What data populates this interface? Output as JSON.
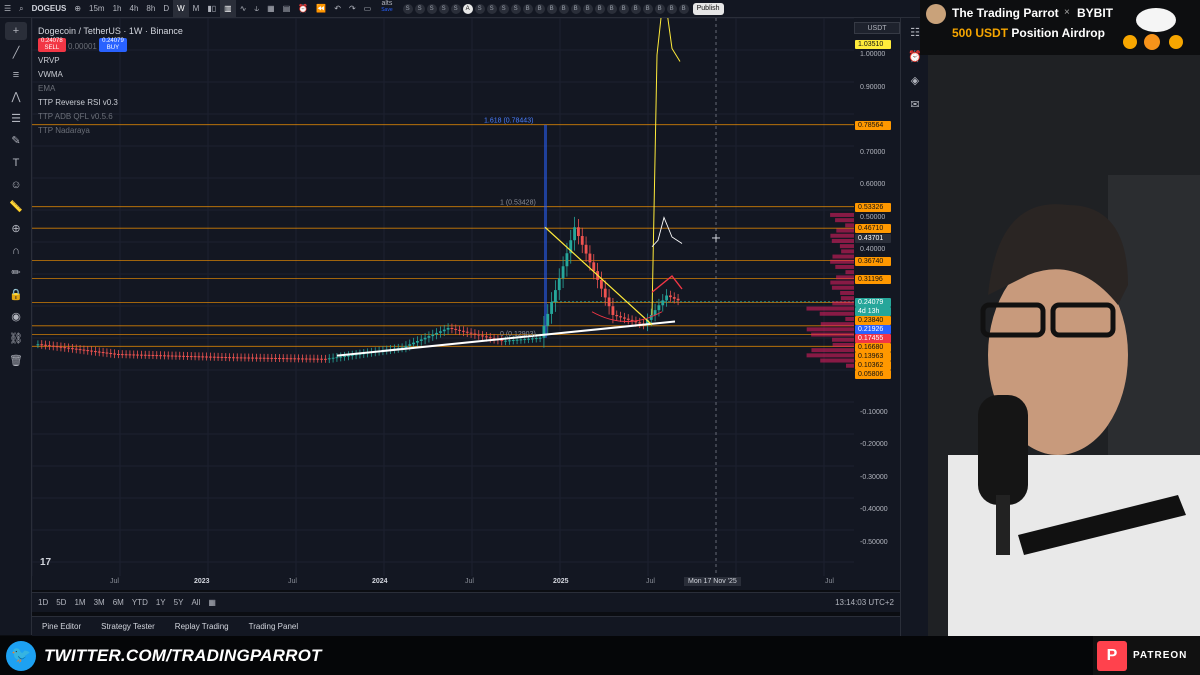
{
  "toolbar": {
    "symbol": "DOGEUS",
    "intervals": [
      "15m",
      "1h",
      "4h",
      "8h",
      "D",
      "W",
      "M"
    ],
    "active_interval": "W",
    "watchlist_name": "alts",
    "watchlist_sub": "Save",
    "watchlist_letters": [
      "S",
      "S",
      "S",
      "S",
      "S",
      "A",
      "S",
      "S",
      "S",
      "S",
      "B",
      "B",
      "B",
      "B",
      "B",
      "B",
      "B",
      "B",
      "B",
      "B",
      "B",
      "B",
      "B",
      "B"
    ],
    "publish_label": "Publish"
  },
  "legend": {
    "title": "Dogecoin / TetherUS · 1W · Binance",
    "sell_price": "0.24078",
    "sell_label": "SELL",
    "spread": "0.00001",
    "buy_price": "0.24079",
    "buy_label": "BUY",
    "indicators": [
      "VRVP",
      "VWMA",
      "EMA",
      "TTP Reverse RSI v0.3",
      "TTP ADB QFL v0.5.6",
      "TTP Nadaraya"
    ]
  },
  "chart_annotations": {
    "fib_top": "1.618 (0.78443)",
    "fib_mid": "1 (0.53428)",
    "fib_low": "0 (0.12903)"
  },
  "price_scale": {
    "currency": "USDT",
    "ticks": [
      "1.00000",
      "0.90000",
      "0.70000",
      "0.60000",
      "0.50000",
      "0.40000",
      "-0.10000",
      "-0.20000",
      "-0.30000",
      "-0.40000",
      "-0.50000"
    ],
    "labels": [
      {
        "text": "1.03510",
        "color": "#ffeb3b"
      },
      {
        "text": "0.78564",
        "color": "#ff9800"
      },
      {
        "text": "0.53326",
        "color": "#ff9800"
      },
      {
        "text": "0.46710",
        "color": "#ff9800"
      },
      {
        "text": "0.43701",
        "color": "#2a2e39"
      },
      {
        "text": "0.36740",
        "color": "#ff9800"
      },
      {
        "text": "0.31196",
        "color": "#ff9800"
      },
      {
        "text": "0.24079",
        "color": "#26a69a"
      },
      {
        "text": "4d 13h",
        "color": "#26a69a"
      },
      {
        "text": "0.23840",
        "color": "#ff9800"
      },
      {
        "text": "0.21926",
        "color": "#2962ff"
      },
      {
        "text": "0.17455",
        "color": "#f23645"
      },
      {
        "text": "0.16680",
        "color": "#ff9800"
      },
      {
        "text": "0.13963",
        "color": "#ff9800"
      },
      {
        "text": "0.10362",
        "color": "#ff9800"
      },
      {
        "text": "0.05806",
        "color": "#ff9800"
      }
    ]
  },
  "time_axis": {
    "labels": [
      "Jul",
      "2023",
      "Jul",
      "2024",
      "Jul",
      "2025",
      "Jul",
      "'25",
      "Jul"
    ],
    "cursor_date": "Mon 17 Nov '25"
  },
  "range_bar": {
    "ranges": [
      "1D",
      "5D",
      "1M",
      "3M",
      "6M",
      "YTD",
      "1Y",
      "5Y",
      "All"
    ],
    "clock": "13:14:03 UTC+2"
  },
  "bottom_tabs": [
    "Pine Editor",
    "Strategy Tester",
    "Replay Trading",
    "Trading Panel"
  ],
  "overlay": {
    "twitter_prefix": "TWITTER.COM/",
    "twitter_handle": "TRADINGPARROT",
    "patreon": "PATREON",
    "sponsor_name": "The Trading Parrot",
    "sponsor_x": "×",
    "sponsor_brand": "BYBIT",
    "promo_amount": "500 USDT",
    "promo_text": "Position Airdrop"
  },
  "chart_data": {
    "type": "candlestick",
    "symbol": "DOGEUSDT",
    "timeframe": "1W",
    "x_range": [
      "2022-03",
      "2025-11"
    ],
    "y_range": [
      -0.55,
      1.05
    ],
    "horizontal_levels": [
      0.78564,
      0.53326,
      0.4671,
      0.3674,
      0.31196,
      0.2384,
      0.1668,
      0.13963,
      0.10362
    ],
    "last_price": 0.24079,
    "colors": {
      "up": "#26a69a",
      "down": "#ef5350",
      "level": "#ff9800",
      "trend_white": "#ffffff",
      "trend_yellow": "#ffeb3b"
    }
  }
}
